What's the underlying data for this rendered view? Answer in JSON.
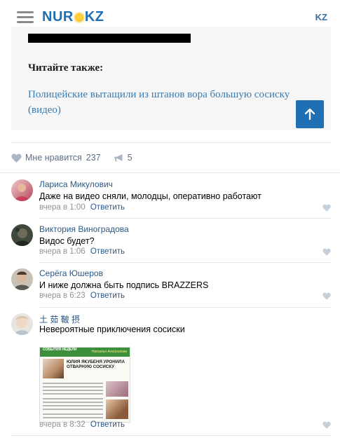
{
  "header": {
    "logo_left": "NUR",
    "logo_right": "KZ",
    "lang": "KZ",
    "brand_color": "#1e6fb4"
  },
  "article": {
    "read_also": "Читайте также:",
    "related_title": "Полицейские вытащили из штанов вора большую сосиску (видео)"
  },
  "reactions": {
    "like_label": "Мне нравится",
    "like_count": "237",
    "share_count": "5"
  },
  "comments": [
    {
      "author": "Лариса Микулович",
      "text": "Даже на видео сняли, молодцы, оперативно работают",
      "time": "вчера в 1:00",
      "reply": "Ответить"
    },
    {
      "author": "Виктория Виноградова",
      "text": "Видос будет?",
      "time": "вчера в 1:06",
      "reply": "Ответить"
    },
    {
      "author": "Серёга Юшеров",
      "text": "И ниже должна быть подпись BRAZZERS",
      "time": "вчера в 6:23",
      "reply": "Ответить"
    },
    {
      "author": "土 茹 鞁 摂",
      "text": "Невероятные приключения сосиски",
      "time": "вчера в 8:32",
      "reply": "Ответить",
      "attachment": {
        "band_label": "СОБЫТИЯ НЕДЕЛИ",
        "band_author": "Наталья Алейникова",
        "headline": "ЮЛИЯ ЯКУБЕНЯ УРОНИЛА ОТВАРНУЮ СОСИСКУ"
      }
    }
  ]
}
